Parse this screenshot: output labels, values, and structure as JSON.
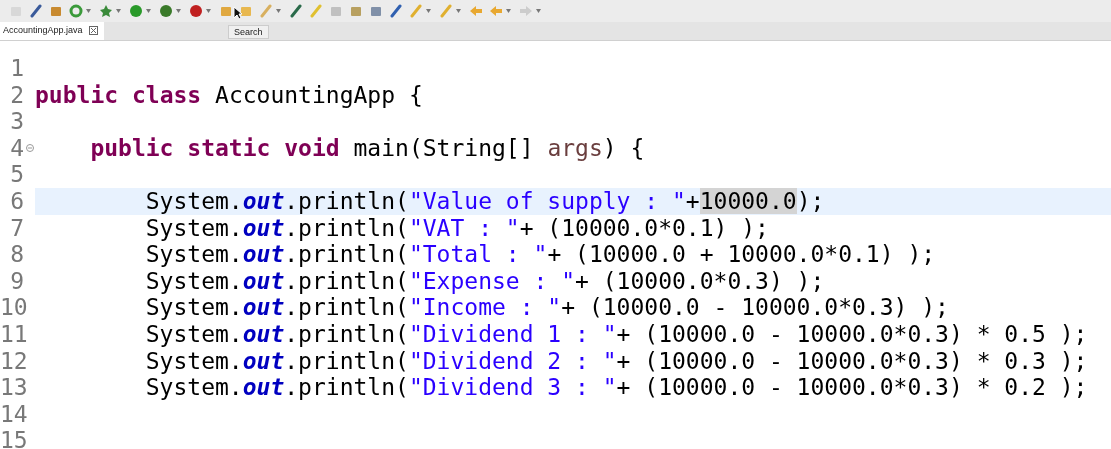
{
  "toolbar": {
    "tooltip": "Search"
  },
  "tabs": [
    {
      "label": "AccountingApp.java",
      "selected": true
    }
  ],
  "editor": {
    "lines": [
      {
        "number": "1",
        "current": false,
        "foldable": false
      },
      {
        "number": "2",
        "current": false,
        "foldable": false,
        "tokens": [
          {
            "kind": "keyword",
            "text": "public"
          },
          {
            "kind": "keyword",
            "text": " class"
          },
          {
            "kind": "plain",
            "text": " AccountingApp {"
          }
        ]
      },
      {
        "number": "3",
        "current": false,
        "foldable": false
      },
      {
        "number": "4",
        "current": false,
        "foldable": true,
        "tokens": [
          {
            "kind": "keyword",
            "text": "    public"
          },
          {
            "kind": "keyword",
            "text": " static"
          },
          {
            "kind": "keyword",
            "text": " void"
          },
          {
            "kind": "plain",
            "text": " main(String[] "
          },
          {
            "kind": "param",
            "text": "args"
          },
          {
            "kind": "plain",
            "text": ") {"
          }
        ]
      },
      {
        "number": "5",
        "current": false,
        "foldable": false
      },
      {
        "number": "6",
        "current": true,
        "foldable": false,
        "tokens": [
          {
            "kind": "plain",
            "text": "        System."
          },
          {
            "kind": "field",
            "text": "out"
          },
          {
            "kind": "plain",
            "text": ".println("
          },
          {
            "kind": "string",
            "text": "\"Value of supply : \""
          },
          {
            "kind": "plain",
            "text": "+"
          },
          {
            "kind": "occurrence",
            "text": "10000.0"
          },
          {
            "kind": "plain",
            "text": ");"
          }
        ]
      },
      {
        "number": "7",
        "current": false,
        "foldable": false,
        "tokens": [
          {
            "kind": "plain",
            "text": "        System."
          },
          {
            "kind": "field",
            "text": "out"
          },
          {
            "kind": "plain",
            "text": ".println("
          },
          {
            "kind": "string",
            "text": "\"VAT : \""
          },
          {
            "kind": "plain",
            "text": "+ (10000.0*0.1) );"
          }
        ]
      },
      {
        "number": "8",
        "current": false,
        "foldable": false,
        "tokens": [
          {
            "kind": "plain",
            "text": "        System."
          },
          {
            "kind": "field",
            "text": "out"
          },
          {
            "kind": "plain",
            "text": ".println("
          },
          {
            "kind": "string",
            "text": "\"Total : \""
          },
          {
            "kind": "plain",
            "text": "+ (10000.0 + 10000.0*0.1) );"
          }
        ]
      },
      {
        "number": "9",
        "current": false,
        "foldable": false,
        "tokens": [
          {
            "kind": "plain",
            "text": "        System."
          },
          {
            "kind": "field",
            "text": "out"
          },
          {
            "kind": "plain",
            "text": ".println("
          },
          {
            "kind": "string",
            "text": "\"Expense : \""
          },
          {
            "kind": "plain",
            "text": "+ (10000.0*0.3) );"
          }
        ]
      },
      {
        "number": "10",
        "current": false,
        "foldable": false,
        "tokens": [
          {
            "kind": "plain",
            "text": "        System."
          },
          {
            "kind": "field",
            "text": "out"
          },
          {
            "kind": "plain",
            "text": ".println("
          },
          {
            "kind": "string",
            "text": "\"Income : \""
          },
          {
            "kind": "plain",
            "text": "+ (10000.0 - 10000.0*0.3) );"
          }
        ]
      },
      {
        "number": "11",
        "current": false,
        "foldable": false,
        "tokens": [
          {
            "kind": "plain",
            "text": "        System."
          },
          {
            "kind": "field",
            "text": "out"
          },
          {
            "kind": "plain",
            "text": ".println("
          },
          {
            "kind": "string",
            "text": "\"Dividend 1 : \""
          },
          {
            "kind": "plain",
            "text": "+ (10000.0 - 10000.0*0.3) * 0.5 );"
          }
        ]
      },
      {
        "number": "12",
        "current": false,
        "foldable": false,
        "tokens": [
          {
            "kind": "plain",
            "text": "        System."
          },
          {
            "kind": "field",
            "text": "out"
          },
          {
            "kind": "plain",
            "text": ".println("
          },
          {
            "kind": "string",
            "text": "\"Dividend 2 : \""
          },
          {
            "kind": "plain",
            "text": "+ (10000.0 - 10000.0*0.3) * 0.3 );"
          }
        ]
      },
      {
        "number": "13",
        "current": false,
        "foldable": false,
        "tokens": [
          {
            "kind": "plain",
            "text": "        System."
          },
          {
            "kind": "field",
            "text": "out"
          },
          {
            "kind": "plain",
            "text": ".println("
          },
          {
            "kind": "string",
            "text": "\"Dividend 3 : \""
          },
          {
            "kind": "plain",
            "text": "+ (10000.0 - 10000.0*0.3) * 0.2 );"
          }
        ]
      },
      {
        "number": "14",
        "current": false,
        "foldable": false
      },
      {
        "number": "15",
        "current": false,
        "foldable": false
      }
    ]
  }
}
